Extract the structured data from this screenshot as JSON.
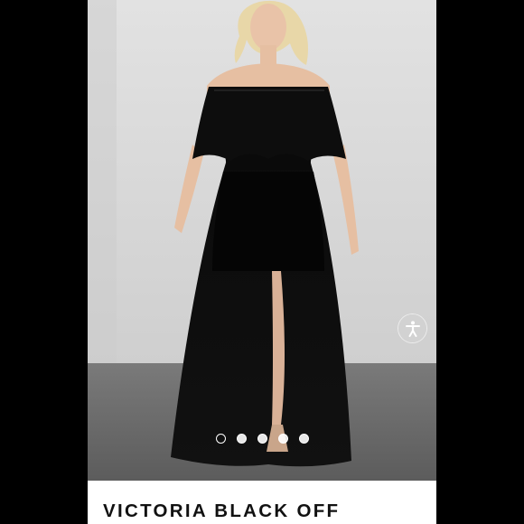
{
  "listing": {
    "title": "VICTORIA BLACK OFF",
    "carousel": {
      "total": 5,
      "active": 1
    },
    "accessibility_button": {
      "icon": "accessibility-person-icon"
    }
  },
  "colors": {
    "backdrop": "#000000",
    "wall": "#d6d6d6",
    "floor": "#6e6e6e",
    "dress": "#0c0c0c"
  }
}
